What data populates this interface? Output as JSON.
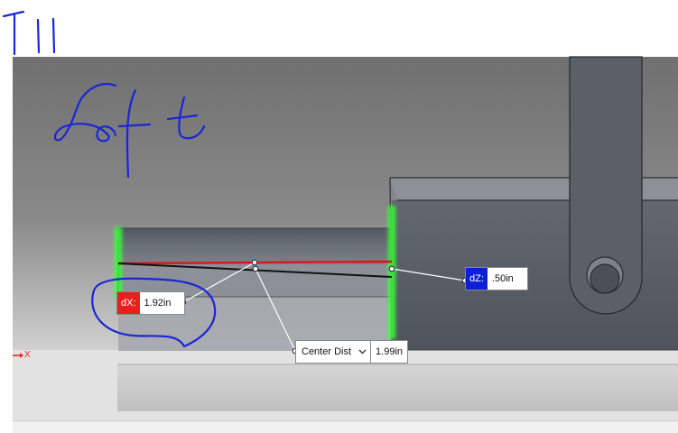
{
  "colors": {
    "dx_tag": "#e81f1f",
    "dz_tag": "#0a1fd6",
    "annotation_ink": "#1a27d6",
    "edge_highlight": "#3cff3c",
    "measure_line": "#e01414"
  },
  "annotation": {
    "page_label": "T11",
    "view_label": "Left"
  },
  "measurements": {
    "dx": {
      "tag": "dX:",
      "value": "1.92in"
    },
    "dz": {
      "tag": "dZ:",
      "value": ".50in"
    },
    "center_dist": {
      "label": "Center Dist",
      "value": "1.99in",
      "icon": "chevron-down-icon"
    }
  },
  "axis": {
    "label": "X",
    "icon": "axis-arrow-icon"
  }
}
